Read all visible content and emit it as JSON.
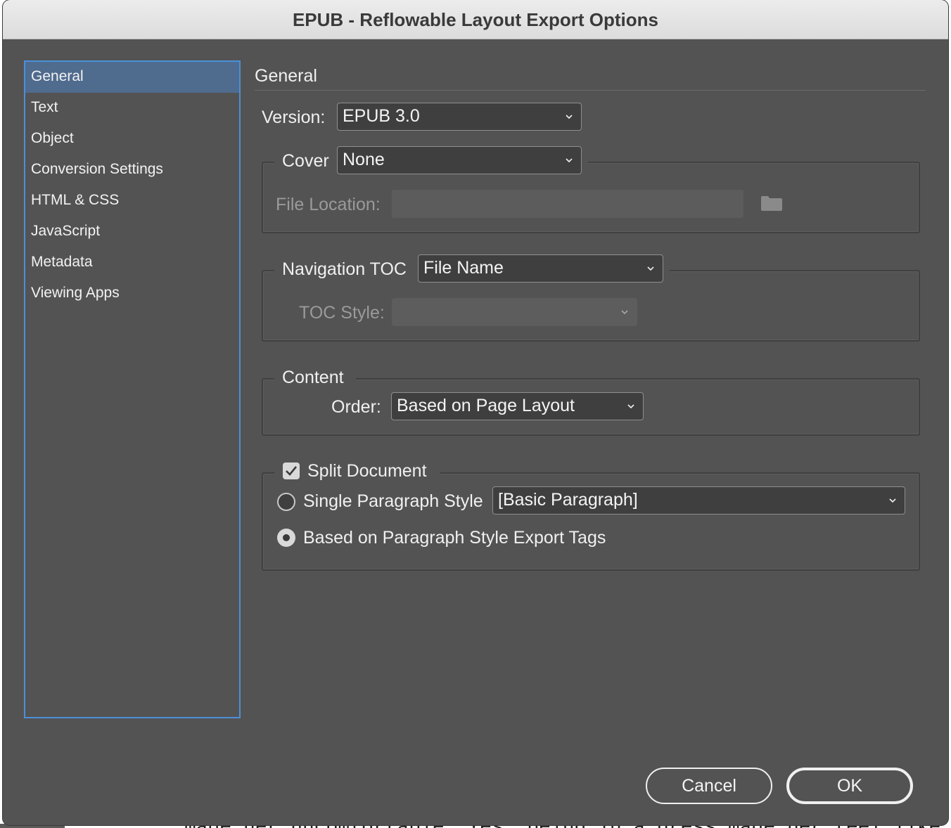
{
  "window": {
    "title": "EPUB - Reflowable Layout Export Options"
  },
  "background": {
    "text": "made her uncomfortable. Yes, being in a dress made her feel like a doll"
  },
  "sidebar": {
    "items": [
      {
        "label": "General",
        "selected": true
      },
      {
        "label": "Text"
      },
      {
        "label": "Object"
      },
      {
        "label": "Conversion Settings"
      },
      {
        "label": "HTML & CSS"
      },
      {
        "label": "JavaScript"
      },
      {
        "label": "Metadata"
      },
      {
        "label": "Viewing Apps"
      }
    ]
  },
  "main": {
    "section_title": "General",
    "version": {
      "label": "Version:",
      "value": "EPUB 3.0"
    },
    "cover": {
      "label": "Cover",
      "value": "None",
      "file_location_label": "File Location:",
      "file_location_value": ""
    },
    "navigation": {
      "label": "Navigation TOC",
      "value": "File Name",
      "toc_style_label": "TOC Style:",
      "toc_style_value": ""
    },
    "content": {
      "label": "Content",
      "order_label": "Order:",
      "order_value": "Based on Page Layout"
    },
    "split": {
      "label": "Split Document",
      "checked": true,
      "single_label": "Single Paragraph Style",
      "single_value": "[Basic Paragraph]",
      "tags_label": "Based on Paragraph Style Export Tags",
      "selected_option": "Based on Paragraph Style Export Tags"
    }
  },
  "buttons": {
    "cancel": "Cancel",
    "ok": "OK"
  },
  "colors": {
    "dialog_bg": "#535353",
    "selection": "#4f6b8e",
    "focus_ring": "#4a90d9"
  },
  "icons": [
    "chevron-down-icon",
    "folder-icon",
    "checkmark-icon"
  ]
}
